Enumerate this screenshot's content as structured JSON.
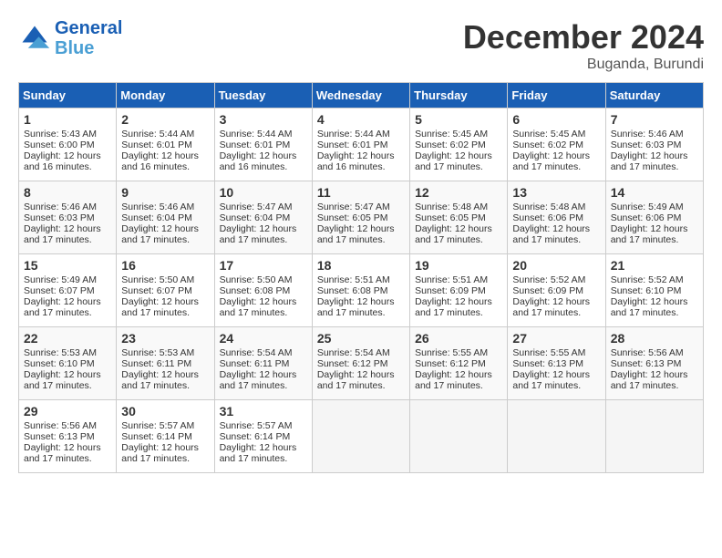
{
  "logo": {
    "line1": "General",
    "line2": "Blue"
  },
  "title": "December 2024",
  "location": "Buganda, Burundi",
  "days_of_week": [
    "Sunday",
    "Monday",
    "Tuesday",
    "Wednesday",
    "Thursday",
    "Friday",
    "Saturday"
  ],
  "weeks": [
    [
      {
        "day": 1,
        "sunrise": "5:43 AM",
        "sunset": "6:00 PM",
        "daylight": "12 hours and 16 minutes."
      },
      {
        "day": 2,
        "sunrise": "5:44 AM",
        "sunset": "6:01 PM",
        "daylight": "12 hours and 16 minutes."
      },
      {
        "day": 3,
        "sunrise": "5:44 AM",
        "sunset": "6:01 PM",
        "daylight": "12 hours and 16 minutes."
      },
      {
        "day": 4,
        "sunrise": "5:44 AM",
        "sunset": "6:01 PM",
        "daylight": "12 hours and 16 minutes."
      },
      {
        "day": 5,
        "sunrise": "5:45 AM",
        "sunset": "6:02 PM",
        "daylight": "12 hours and 17 minutes."
      },
      {
        "day": 6,
        "sunrise": "5:45 AM",
        "sunset": "6:02 PM",
        "daylight": "12 hours and 17 minutes."
      },
      {
        "day": 7,
        "sunrise": "5:46 AM",
        "sunset": "6:03 PM",
        "daylight": "12 hours and 17 minutes."
      }
    ],
    [
      {
        "day": 8,
        "sunrise": "5:46 AM",
        "sunset": "6:03 PM",
        "daylight": "12 hours and 17 minutes."
      },
      {
        "day": 9,
        "sunrise": "5:46 AM",
        "sunset": "6:04 PM",
        "daylight": "12 hours and 17 minutes."
      },
      {
        "day": 10,
        "sunrise": "5:47 AM",
        "sunset": "6:04 PM",
        "daylight": "12 hours and 17 minutes."
      },
      {
        "day": 11,
        "sunrise": "5:47 AM",
        "sunset": "6:05 PM",
        "daylight": "12 hours and 17 minutes."
      },
      {
        "day": 12,
        "sunrise": "5:48 AM",
        "sunset": "6:05 PM",
        "daylight": "12 hours and 17 minutes."
      },
      {
        "day": 13,
        "sunrise": "5:48 AM",
        "sunset": "6:06 PM",
        "daylight": "12 hours and 17 minutes."
      },
      {
        "day": 14,
        "sunrise": "5:49 AM",
        "sunset": "6:06 PM",
        "daylight": "12 hours and 17 minutes."
      }
    ],
    [
      {
        "day": 15,
        "sunrise": "5:49 AM",
        "sunset": "6:07 PM",
        "daylight": "12 hours and 17 minutes."
      },
      {
        "day": 16,
        "sunrise": "5:50 AM",
        "sunset": "6:07 PM",
        "daylight": "12 hours and 17 minutes."
      },
      {
        "day": 17,
        "sunrise": "5:50 AM",
        "sunset": "6:08 PM",
        "daylight": "12 hours and 17 minutes."
      },
      {
        "day": 18,
        "sunrise": "5:51 AM",
        "sunset": "6:08 PM",
        "daylight": "12 hours and 17 minutes."
      },
      {
        "day": 19,
        "sunrise": "5:51 AM",
        "sunset": "6:09 PM",
        "daylight": "12 hours and 17 minutes."
      },
      {
        "day": 20,
        "sunrise": "5:52 AM",
        "sunset": "6:09 PM",
        "daylight": "12 hours and 17 minutes."
      },
      {
        "day": 21,
        "sunrise": "5:52 AM",
        "sunset": "6:10 PM",
        "daylight": "12 hours and 17 minutes."
      }
    ],
    [
      {
        "day": 22,
        "sunrise": "5:53 AM",
        "sunset": "6:10 PM",
        "daylight": "12 hours and 17 minutes."
      },
      {
        "day": 23,
        "sunrise": "5:53 AM",
        "sunset": "6:11 PM",
        "daylight": "12 hours and 17 minutes."
      },
      {
        "day": 24,
        "sunrise": "5:54 AM",
        "sunset": "6:11 PM",
        "daylight": "12 hours and 17 minutes."
      },
      {
        "day": 25,
        "sunrise": "5:54 AM",
        "sunset": "6:12 PM",
        "daylight": "12 hours and 17 minutes."
      },
      {
        "day": 26,
        "sunrise": "5:55 AM",
        "sunset": "6:12 PM",
        "daylight": "12 hours and 17 minutes."
      },
      {
        "day": 27,
        "sunrise": "5:55 AM",
        "sunset": "6:13 PM",
        "daylight": "12 hours and 17 minutes."
      },
      {
        "day": 28,
        "sunrise": "5:56 AM",
        "sunset": "6:13 PM",
        "daylight": "12 hours and 17 minutes."
      }
    ],
    [
      {
        "day": 29,
        "sunrise": "5:56 AM",
        "sunset": "6:13 PM",
        "daylight": "12 hours and 17 minutes."
      },
      {
        "day": 30,
        "sunrise": "5:57 AM",
        "sunset": "6:14 PM",
        "daylight": "12 hours and 17 minutes."
      },
      {
        "day": 31,
        "sunrise": "5:57 AM",
        "sunset": "6:14 PM",
        "daylight": "12 hours and 17 minutes."
      },
      null,
      null,
      null,
      null
    ]
  ]
}
